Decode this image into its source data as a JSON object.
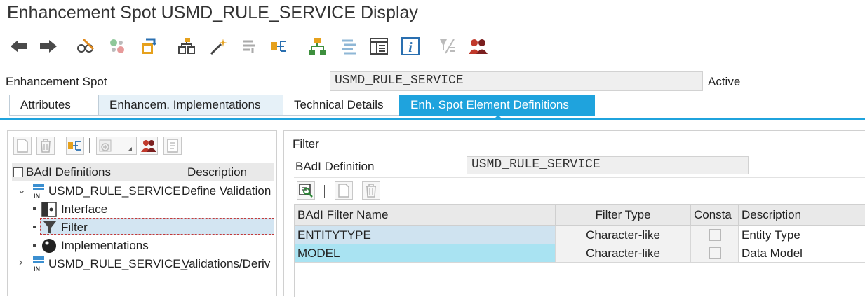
{
  "window": {
    "title": "Enhancement Spot USMD_RULE_SERVICE Display"
  },
  "toolbar": {
    "icons": [
      "back-arrow-icon",
      "forward-arrow-icon",
      "display-change-icon",
      "other-object-icon",
      "activate-icon",
      "where-used-icon",
      "wizard-icon",
      "check-icon",
      "enhancement-link-icon",
      "hierarchy-icon",
      "object-list-icon",
      "screen-layout-icon",
      "info-icon",
      "delete-filter-icon",
      "users-icon"
    ]
  },
  "header": {
    "label": "Enhancement Spot",
    "value": "USMD_RULE_SERVICE",
    "status": "Active"
  },
  "tabs": [
    {
      "label": "Attributes",
      "state": "normal"
    },
    {
      "label": "Enhancem. Implementations",
      "state": "alt"
    },
    {
      "label": "Technical Details",
      "state": "normal"
    },
    {
      "label": "Enh. Spot Element Definitions",
      "state": "active"
    }
  ],
  "tree": {
    "columns": [
      "BAdI Definitions",
      "Description"
    ],
    "nodes": [
      {
        "label": "USMD_RULE_SERVICE",
        "description": "Define Validation",
        "expanded": true
      },
      {
        "label": "Interface"
      },
      {
        "label": "Filter",
        "selected": true
      },
      {
        "label": "Implementations"
      },
      {
        "label": "USMD_RULE_SERVICE_",
        "description": "Validations/Deriv",
        "expanded": false
      }
    ]
  },
  "filter_panel": {
    "title": "Filter",
    "badi_label": "BAdI Definition",
    "badi_value": "USMD_RULE_SERVICE",
    "grid": {
      "columns": [
        "BAdI Filter Name",
        "Filter Type",
        "Consta",
        "Description"
      ],
      "rows": [
        {
          "name": "ENTITYTYPE",
          "type": "Character-like",
          "constant": false,
          "description": "Entity Type"
        },
        {
          "name": "MODEL",
          "type": "Character-like",
          "constant": false,
          "description": "Data Model"
        }
      ]
    }
  },
  "colors": {
    "accent": "#1fa3dd",
    "selected_row": "#cfe3f0",
    "selected_row_alt": "#a9e3f2"
  }
}
